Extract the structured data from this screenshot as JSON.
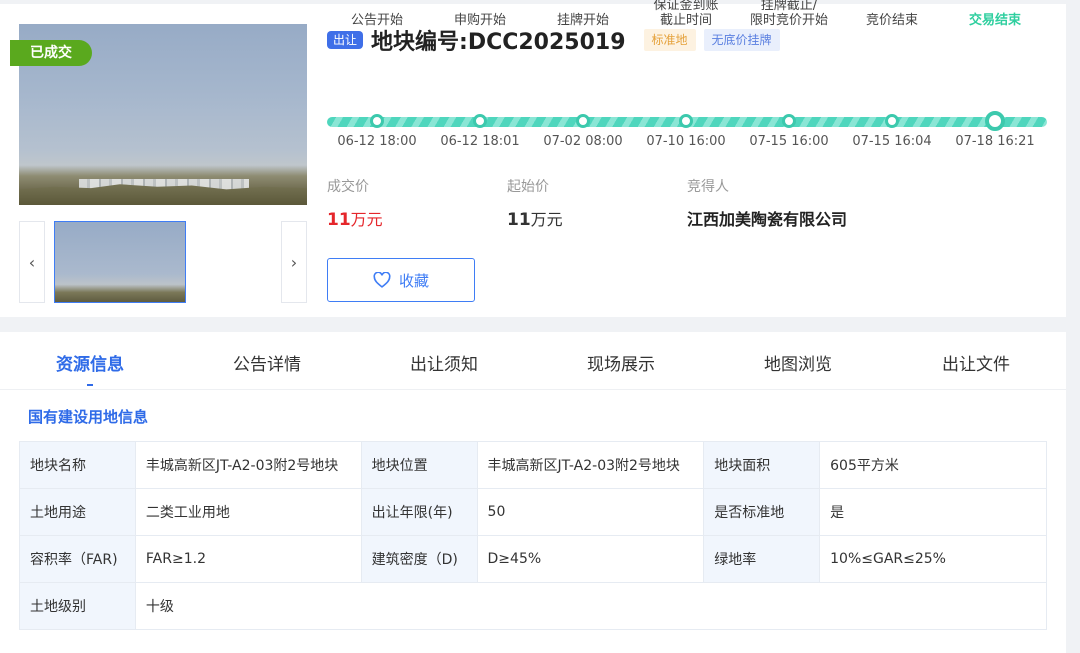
{
  "status_badge": "已成交",
  "gallery": {
    "prev": "‹",
    "next": "›"
  },
  "header": {
    "type_tag": "出让",
    "plot_title": "地块编号:DCC2025019",
    "tags": [
      "标准地",
      "无底价挂牌"
    ]
  },
  "timeline": [
    {
      "label": "公告开始",
      "time": "06-12 18:00"
    },
    {
      "label": "申购开始",
      "time": "06-12 18:01"
    },
    {
      "label": "挂牌开始",
      "time": "07-02 08:00"
    },
    {
      "label": "保证金到账\n截止时间",
      "time": "07-10 16:00"
    },
    {
      "label": "挂牌截止/\n限时竞价开始",
      "time": "07-15 16:00"
    },
    {
      "label": "竞价结束",
      "time": "07-15 16:04"
    },
    {
      "label": "交易结束",
      "time": "07-18 16:21"
    }
  ],
  "prices": {
    "deal_label": "成交价",
    "deal_num": "11",
    "deal_unit": "万元",
    "start_label": "起始价",
    "start_num": "11",
    "start_unit": "万元",
    "winner_label": "竞得人",
    "winner": "江西加美陶瓷有限公司"
  },
  "favorite_label": "收藏",
  "tabs": [
    "资源信息",
    "公告详情",
    "出让须知",
    "现场展示",
    "地图浏览",
    "出让文件"
  ],
  "section_title": "国有建设用地信息",
  "info_rows": [
    [
      [
        "地块名称",
        "丰城高新区JT-A2-03附2号地块"
      ],
      [
        "地块位置",
        "丰城高新区JT-A2-03附2号地块"
      ],
      [
        "地块面积",
        "605平方米"
      ]
    ],
    [
      [
        "土地用途",
        "二类工业用地"
      ],
      [
        "出让年限(年)",
        "50"
      ],
      [
        "是否标准地",
        "是"
      ]
    ],
    [
      [
        "容积率（FAR)",
        "FAR≥1.2"
      ],
      [
        "建筑密度（D)",
        "D≥45%"
      ],
      [
        "绿地率",
        "10%≤GAR≤25%"
      ]
    ],
    [
      [
        "土地级别",
        "十级"
      ]
    ]
  ],
  "colors": {
    "accent": "#2f6be8",
    "deal_red": "#e5262b",
    "success_green": "#5aa91e",
    "timeline_teal": "#3cc9ad"
  }
}
